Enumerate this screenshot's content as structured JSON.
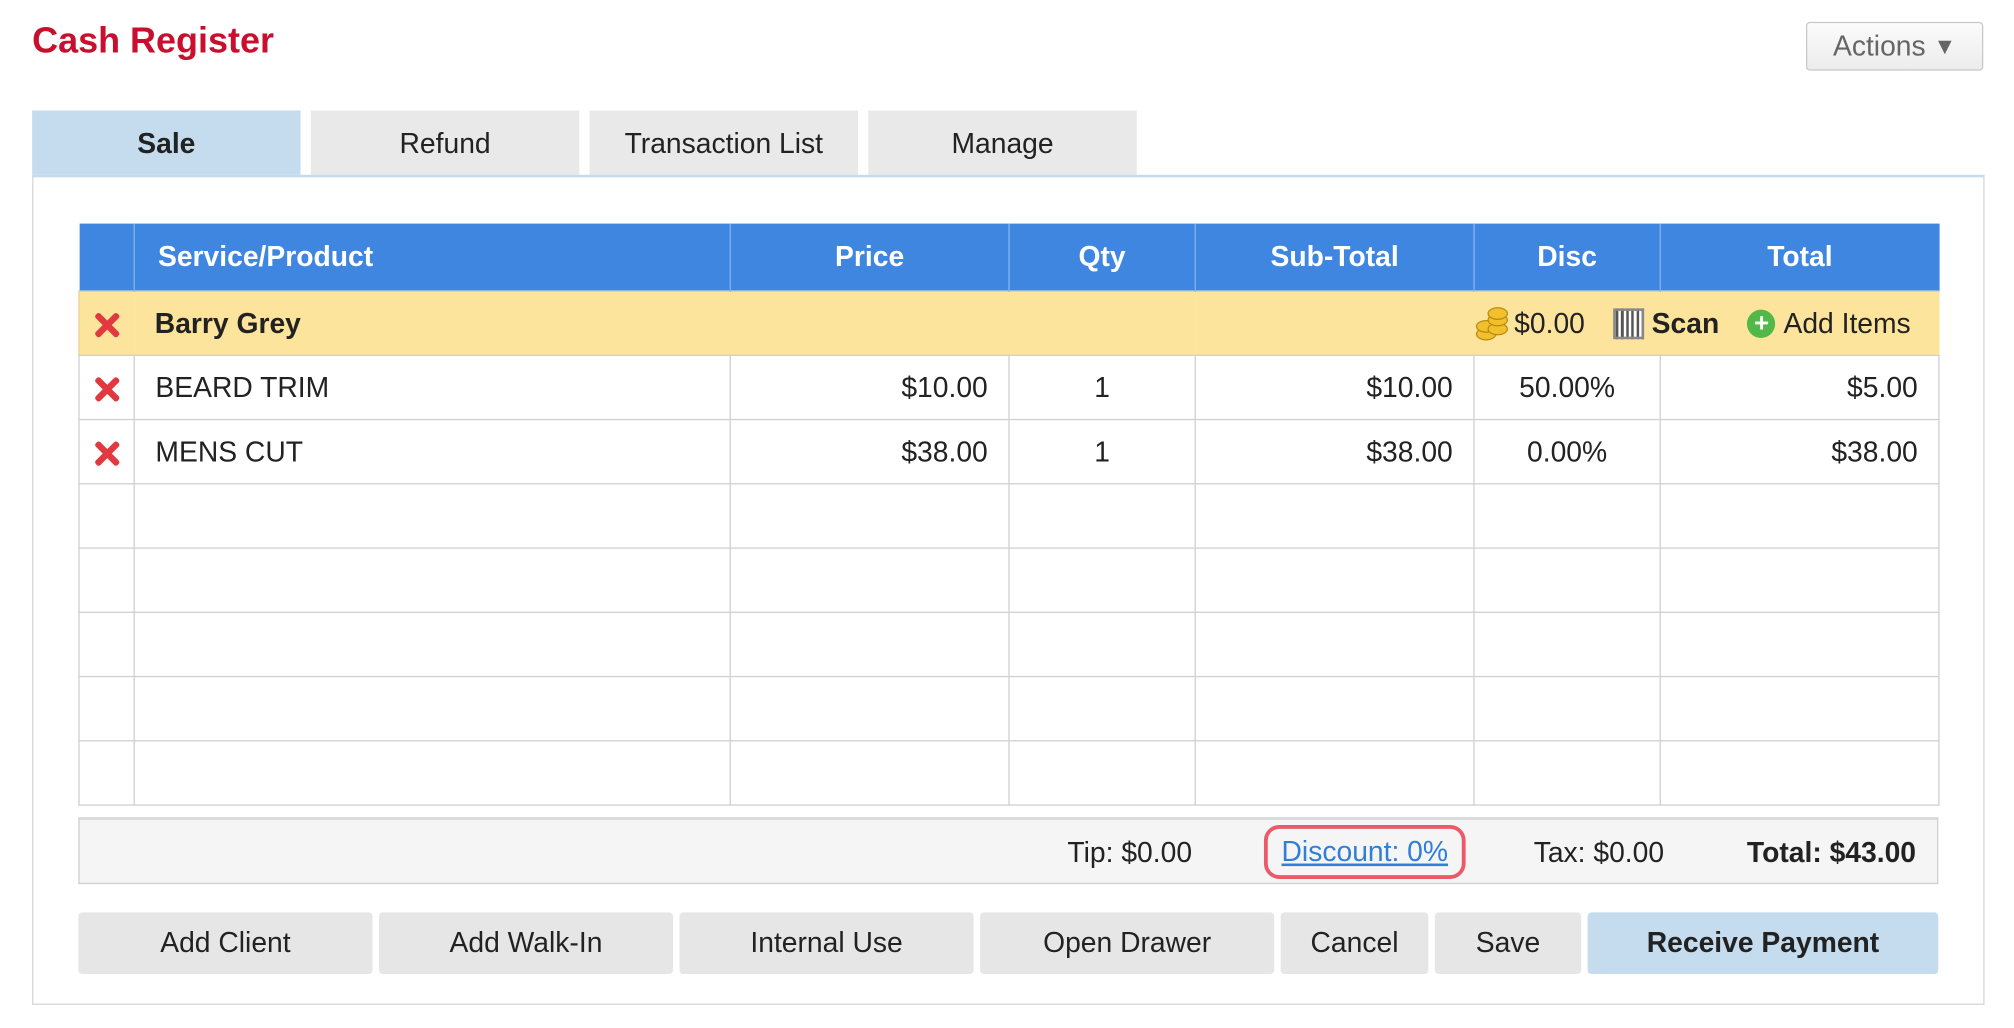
{
  "header": {
    "title": "Cash Register",
    "actions_label": "Actions"
  },
  "tabs": [
    {
      "label": "Sale",
      "active": true
    },
    {
      "label": "Refund",
      "active": false
    },
    {
      "label": "Transaction List",
      "active": false
    },
    {
      "label": "Manage",
      "active": false
    }
  ],
  "table": {
    "columns": [
      "Service/Product",
      "Price",
      "Qty",
      "Sub-Total",
      "Disc",
      "Total"
    ],
    "client": {
      "name": "Barry Grey",
      "balance": "$0.00",
      "scan_label": "Scan",
      "add_items_label": "Add Items"
    },
    "rows": [
      {
        "item": "BEARD TRIM",
        "price": "$10.00",
        "qty": "1",
        "subtotal": "$10.00",
        "disc": "50.00%",
        "total": "$5.00"
      },
      {
        "item": "MENS CUT",
        "price": "$38.00",
        "qty": "1",
        "subtotal": "$38.00",
        "disc": "0.00%",
        "total": "$38.00"
      }
    ]
  },
  "summary": {
    "tip": "Tip: $0.00",
    "discount": "Discount: 0%",
    "tax": "Tax: $0.00",
    "total": "Total: $43.00"
  },
  "buttons": {
    "add_client": "Add Client",
    "add_walk_in": "Add Walk-In",
    "internal_use": "Internal Use",
    "open_drawer": "Open Drawer",
    "cancel": "Cancel",
    "save": "Save",
    "receive_payment": "Receive Payment"
  },
  "colors": {
    "title_red": "#c8102e",
    "header_blue": "#3f86e0",
    "active_tab": "#c5dcee",
    "client_row": "#fde49c",
    "delete_red": "#e2383f",
    "discount_highlight": "#ec5a6a"
  }
}
